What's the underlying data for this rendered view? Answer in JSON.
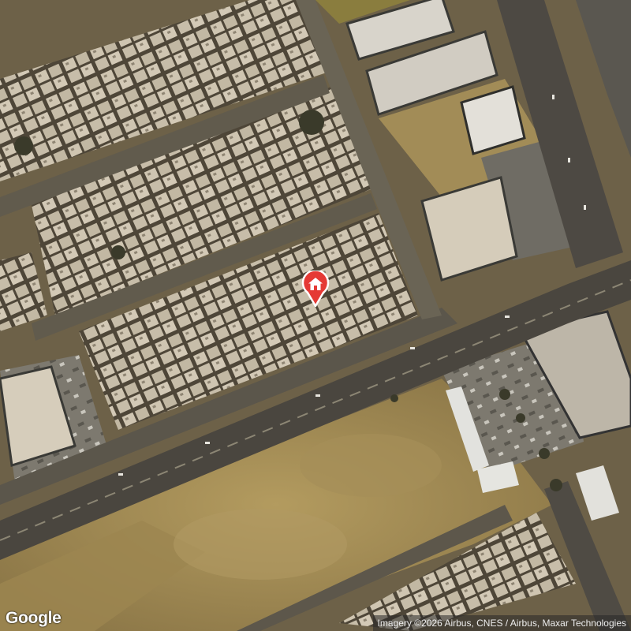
{
  "map": {
    "view": "satellite",
    "logo_text": "Google",
    "attribution": "Imagery ©2026 Airbus, CNES / Airbus, Maxar Technologies",
    "marker": {
      "icon": "home-icon",
      "color": "#e53935"
    }
  },
  "colors": {
    "ground": "#6d6148",
    "dirt": "#a08a52",
    "road": "#4a463f",
    "rooftop": "#c9bfad",
    "marker": "#e53935"
  }
}
